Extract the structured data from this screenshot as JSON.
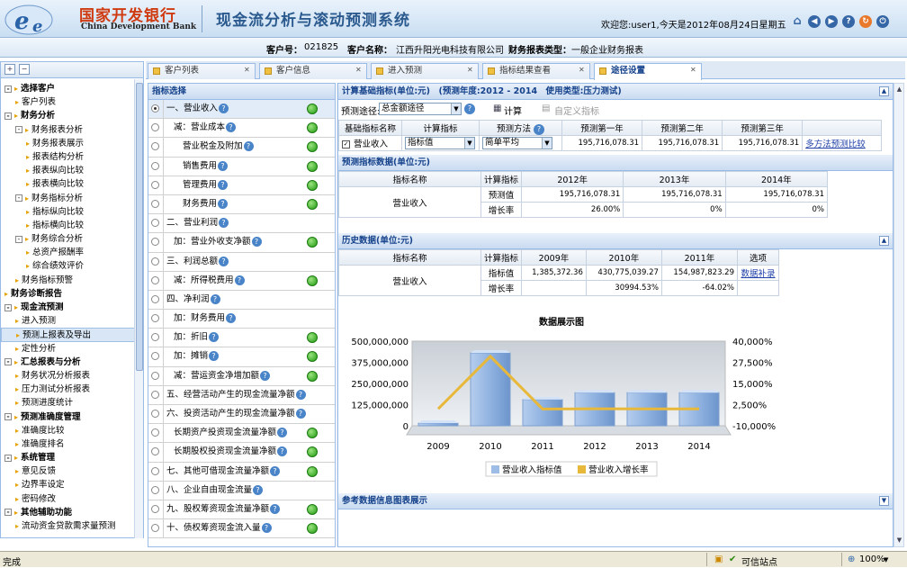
{
  "header": {
    "bank_name_cn": "国家开发银行",
    "bank_name_en": "China Development Bank",
    "system_title": "现金流分析与滚动预测系统",
    "welcome": "欢迎您:user1,今天是2012年08月24日星期五"
  },
  "customer_bar": {
    "id_label": "客户号：",
    "id_value": "021825",
    "name_label": "客户名称：",
    "name_value": "江西升阳光电科技有限公司",
    "type_label": "财务报表类型：",
    "type_value": "一般企业财务报表"
  },
  "sidebar": {
    "items": [
      {
        "label": "选择客户",
        "level": 0,
        "bold": true,
        "toggle": "-"
      },
      {
        "label": "客户列表",
        "level": 1
      },
      {
        "label": "财务分析",
        "level": 0,
        "bold": true,
        "toggle": "-"
      },
      {
        "label": "财务报表分析",
        "level": 1,
        "toggle": "-"
      },
      {
        "label": "财务报表展示",
        "level": 2
      },
      {
        "label": "报表结构分析",
        "level": 2
      },
      {
        "label": "报表纵向比较",
        "level": 2
      },
      {
        "label": "报表横向比较",
        "level": 2
      },
      {
        "label": "财务指标分析",
        "level": 1,
        "toggle": "-"
      },
      {
        "label": "指标纵向比较",
        "level": 2
      },
      {
        "label": "指标横向比较",
        "level": 2
      },
      {
        "label": "财务综合分析",
        "level": 1,
        "toggle": "-"
      },
      {
        "label": "总资产报酬率",
        "level": 2
      },
      {
        "label": "综合绩效评价",
        "level": 2
      },
      {
        "label": "财务指标预警",
        "level": 1
      },
      {
        "label": "财务诊断报告",
        "level": 0,
        "bold": true
      },
      {
        "label": "现金流预测",
        "level": 0,
        "bold": true,
        "toggle": "-"
      },
      {
        "label": "进入预测",
        "level": 1
      },
      {
        "label": "预测上报表及导出",
        "level": 1,
        "selected": true
      },
      {
        "label": "定性分析",
        "level": 1
      },
      {
        "label": "汇总报表与分析",
        "level": 0,
        "bold": true,
        "toggle": "-"
      },
      {
        "label": "财务状况分析报表",
        "level": 1
      },
      {
        "label": "压力测试分析报表",
        "level": 1
      },
      {
        "label": "预测进度统计",
        "level": 1
      },
      {
        "label": "预测准确度管理",
        "level": 0,
        "bold": true,
        "toggle": "-"
      },
      {
        "label": "准确度比较",
        "level": 1
      },
      {
        "label": "准确度排名",
        "level": 1
      },
      {
        "label": "系统管理",
        "level": 0,
        "bold": true,
        "toggle": "-"
      },
      {
        "label": "意见反馈",
        "level": 1
      },
      {
        "label": "边界率设定",
        "level": 1
      },
      {
        "label": "密码修改",
        "level": 1
      },
      {
        "label": "其他辅助功能",
        "level": 0,
        "bold": true,
        "toggle": "-"
      },
      {
        "label": "流动资金贷款需求量预测",
        "level": 1
      }
    ]
  },
  "tabs": [
    {
      "label": "客户列表",
      "active": false
    },
    {
      "label": "客户信息",
      "active": false
    },
    {
      "label": "进入预测",
      "active": false
    },
    {
      "label": "指标结果查看",
      "active": false
    },
    {
      "label": "途径设置",
      "active": true
    }
  ],
  "indicator_panel": {
    "title": "指标选择",
    "rows": [
      {
        "label": "一、营业收入",
        "indent": 0,
        "help": true,
        "dot": true,
        "selected": true
      },
      {
        "label": "减：营业成本",
        "indent": 1,
        "help": true,
        "dot": true
      },
      {
        "label": "营业税金及附加",
        "indent": 2,
        "help": true,
        "dot": true
      },
      {
        "label": "销售费用",
        "indent": 2,
        "help": true,
        "dot": true
      },
      {
        "label": "管理费用",
        "indent": 2,
        "help": true,
        "dot": true
      },
      {
        "label": "财务费用",
        "indent": 2,
        "help": true,
        "dot": true
      },
      {
        "label": "二、营业利润",
        "indent": 0,
        "help": true,
        "dot": false
      },
      {
        "label": "加：营业外收支净额",
        "indent": 1,
        "help": true,
        "dot": true
      },
      {
        "label": "三、利润总额",
        "indent": 0,
        "help": true,
        "dot": false
      },
      {
        "label": "减：所得税费用",
        "indent": 1,
        "help": true,
        "dot": true
      },
      {
        "label": "四、净利润",
        "indent": 0,
        "help": true,
        "dot": false
      },
      {
        "label": "加：财务费用",
        "indent": 1,
        "help": true,
        "dot": false
      },
      {
        "label": "加：折旧",
        "indent": 1,
        "help": true,
        "dot": true
      },
      {
        "label": "加：摊销",
        "indent": 1,
        "help": true,
        "dot": true
      },
      {
        "label": "减：营运资金净增加额",
        "indent": 1,
        "help": true,
        "dot": true
      },
      {
        "label": "五、经营活动产生的现金流量净额",
        "indent": 0,
        "help": true,
        "dot": false
      },
      {
        "label": "六、投资活动产生的现金流量净额",
        "indent": 0,
        "help": true,
        "dot": false
      },
      {
        "label": "长期资产投资现金流量净额",
        "indent": 1,
        "help": true,
        "dot": true
      },
      {
        "label": "长期股权投资现金流量净额",
        "indent": 1,
        "help": true,
        "dot": true
      },
      {
        "label": "七、其他可借现金流量净额",
        "indent": 0,
        "help": true,
        "dot": true
      },
      {
        "label": "八、企业自由现金流量",
        "indent": 0,
        "help": true,
        "dot": false
      },
      {
        "label": "九、股权筹资现金流量净额",
        "indent": 0,
        "help": true,
        "dot": true
      },
      {
        "label": "十、债权筹资现金流入量",
        "indent": 0,
        "help": true,
        "dot": true
      }
    ]
  },
  "calc_panel": {
    "title": "计算基础指标(单位:元)　(预测年度:2012 - 2014　使用类型:压力测试)",
    "path_label": "预测途径:",
    "path_value": "总金额途径",
    "calc_button": "计算",
    "custom_button": "自定义指标",
    "columns": [
      "基础指标名称",
      "计算指标",
      "预测方法",
      "预测第一年",
      "预测第二年",
      "预测第三年"
    ],
    "row": {
      "name": "营业收入",
      "calc_indicator": "指标值",
      "method": "简单平均",
      "y1": "195,716,078.31",
      "y2": "195,716,078.31",
      "y3": "195,716,078.31",
      "link": "多方法预测比较"
    }
  },
  "forecast_panel": {
    "title": "预测指标数据(单位:元)",
    "col_name": "指标名称",
    "col_calc": "计算指标",
    "years": [
      "2012年",
      "2013年",
      "2014年"
    ],
    "indicator": "营业收入",
    "rows": [
      {
        "label": "预测值",
        "values": [
          "195,716,078.31",
          "195,716,078.31",
          "195,716,078.31"
        ]
      },
      {
        "label": "增长率",
        "values": [
          "26.00%",
          "0%",
          "0%"
        ]
      }
    ]
  },
  "history_panel": {
    "title": "历史数据(单位:元)",
    "col_name": "指标名称",
    "col_calc": "计算指标",
    "years": [
      "2009年",
      "2010年",
      "2011年"
    ],
    "col_option": "选项",
    "indicator": "营业收入",
    "rows": [
      {
        "label": "指标值",
        "values": [
          "1,385,372.36",
          "430,775,039.27",
          "154,987,823.29"
        ]
      },
      {
        "label": "增长率",
        "values": [
          "",
          "30994.53%",
          "-64.02%"
        ]
      }
    ],
    "option_link": "数据补录"
  },
  "chart_data": {
    "type": "bar",
    "title": "数据展示图",
    "categories": [
      "2009",
      "2010",
      "2011",
      "2012",
      "2013",
      "2014"
    ],
    "series": [
      {
        "name": "营业收入指标值",
        "type": "bar",
        "axis": "left",
        "color": "#9dbde6",
        "values": [
          1385372.36,
          430775039.27,
          154987823.29,
          195716078.31,
          195716078.31,
          195716078.31
        ]
      },
      {
        "name": "营业收入增长率",
        "type": "line",
        "axis": "right",
        "color": "#e8b83a",
        "values": [
          null,
          30994.53,
          -64.02,
          26.0,
          0,
          0
        ]
      }
    ],
    "y_left_ticks": [
      "500,000,000",
      "375,000,000",
      "250,000,000",
      "125,000,000",
      "0"
    ],
    "y_left_range": [
      0,
      500000000
    ],
    "y_right_ticks": [
      "40,000%",
      "27,500%",
      "15,000%",
      "2,500%",
      "-10,000%"
    ],
    "y_right_range": [
      -10000,
      40000
    ],
    "legend": "bottom"
  },
  "ref_panel": {
    "title": "参考数据信息图表展示"
  },
  "statusbar": {
    "left": "完成",
    "zone": "可信站点",
    "zoom": "100%"
  },
  "colors": {
    "panel_header": "#c9dbf1",
    "link": "#1e3fa8",
    "green_dot": "#1f9a10",
    "brand_red": "#d03a10"
  }
}
